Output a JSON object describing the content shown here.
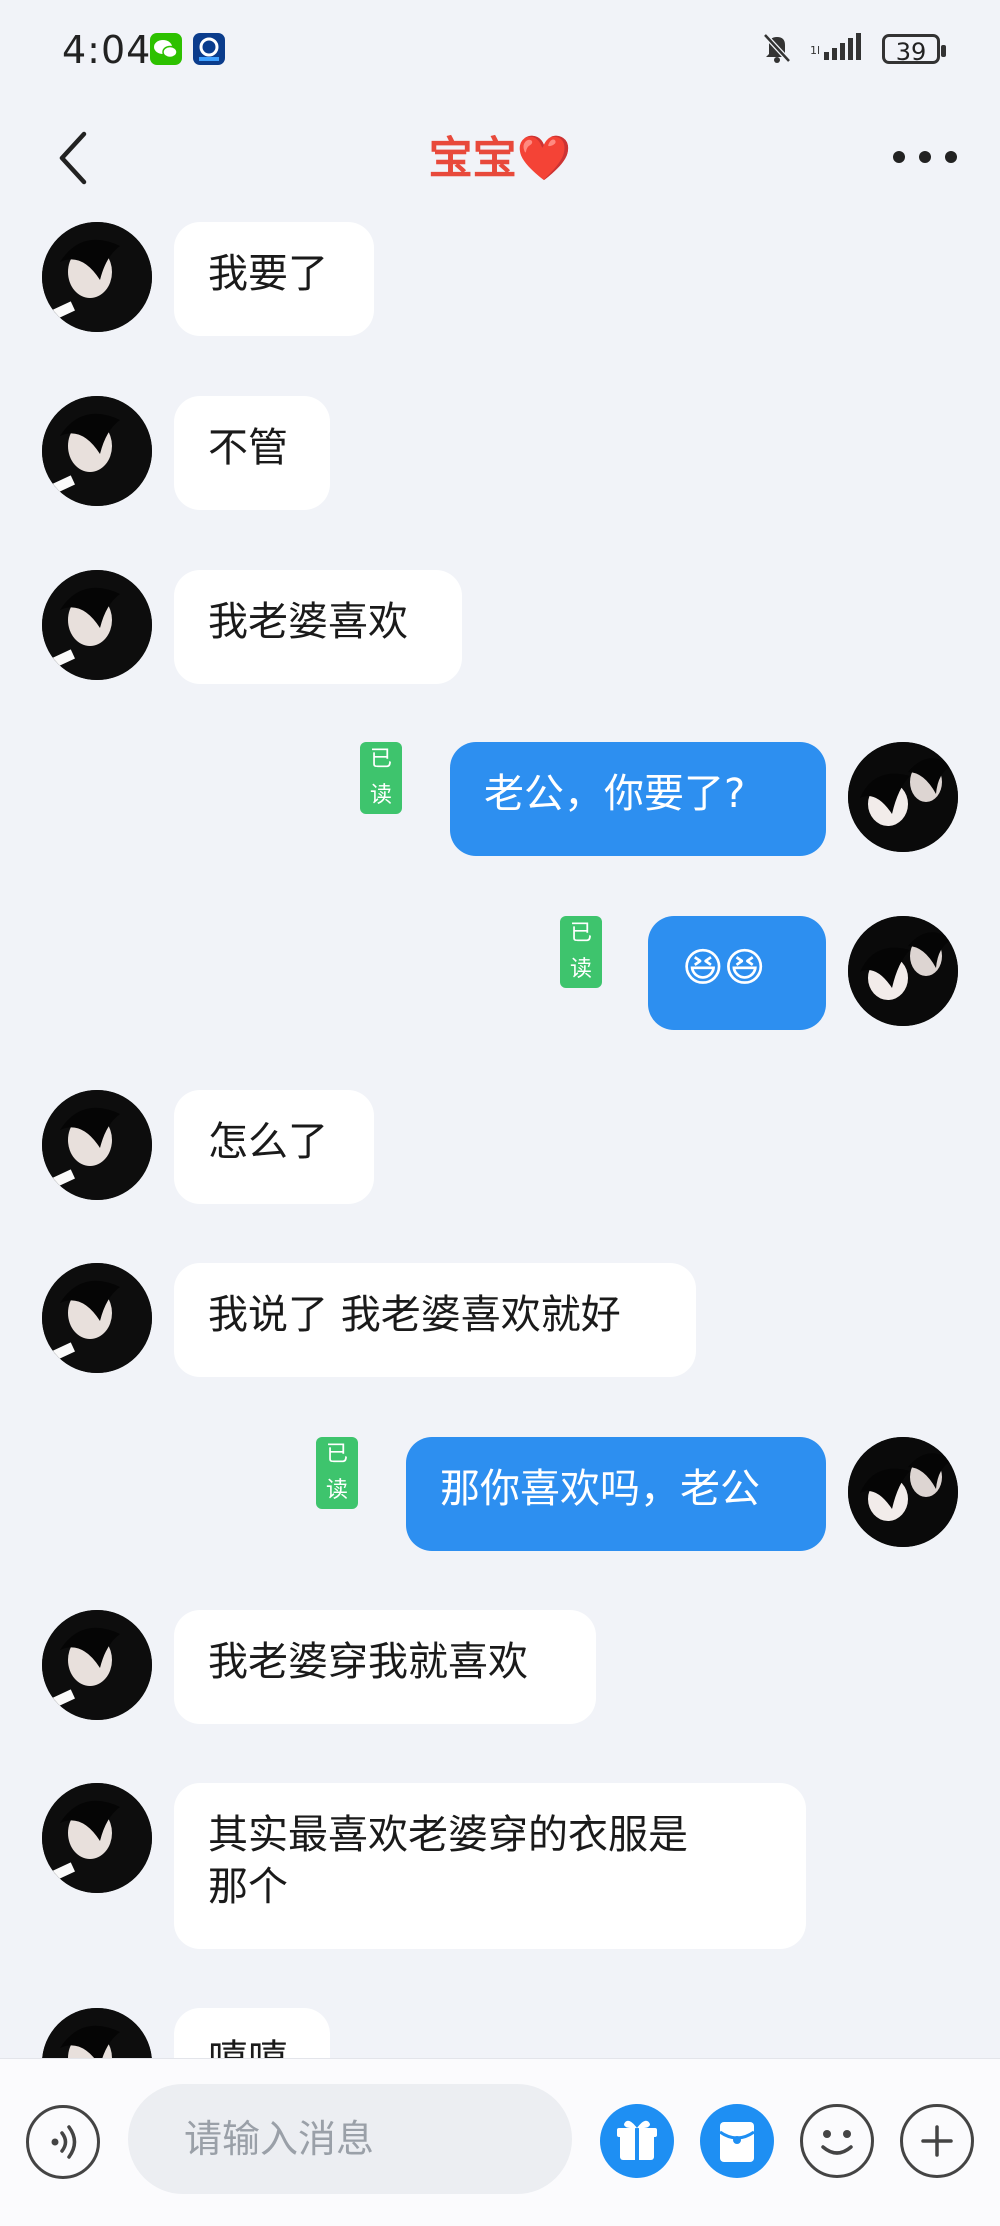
{
  "status_bar": {
    "time": "4:04",
    "battery": "39"
  },
  "header": {
    "title": "宝宝",
    "title_emoji": "❤️"
  },
  "messages": [
    {
      "direction": "in",
      "text": "我要了"
    },
    {
      "direction": "in",
      "text": "不管"
    },
    {
      "direction": "in",
      "text": "我老婆喜欢"
    },
    {
      "direction": "out",
      "text": "老公，你要了?",
      "read_label": "已读"
    },
    {
      "direction": "out",
      "text": "😆😆",
      "read_label": "已读"
    },
    {
      "direction": "in",
      "text": "怎么了"
    },
    {
      "direction": "in",
      "text": "我说了 我老婆喜欢就好"
    },
    {
      "direction": "out",
      "text": "那你喜欢吗，老公",
      "read_label": "已读"
    },
    {
      "direction": "in",
      "text": "我老婆穿我就喜欢"
    },
    {
      "direction": "in",
      "text": "其实最喜欢老婆穿的衣服是\n那个"
    },
    {
      "direction": "in",
      "text": "嘻嘻"
    }
  ],
  "input": {
    "placeholder": "请输入消息"
  },
  "colors": {
    "outgoing_bubble": "#2d8ff0",
    "incoming_bubble": "#ffffff",
    "read_badge": "#3ec46d",
    "title": "#e8493b"
  }
}
